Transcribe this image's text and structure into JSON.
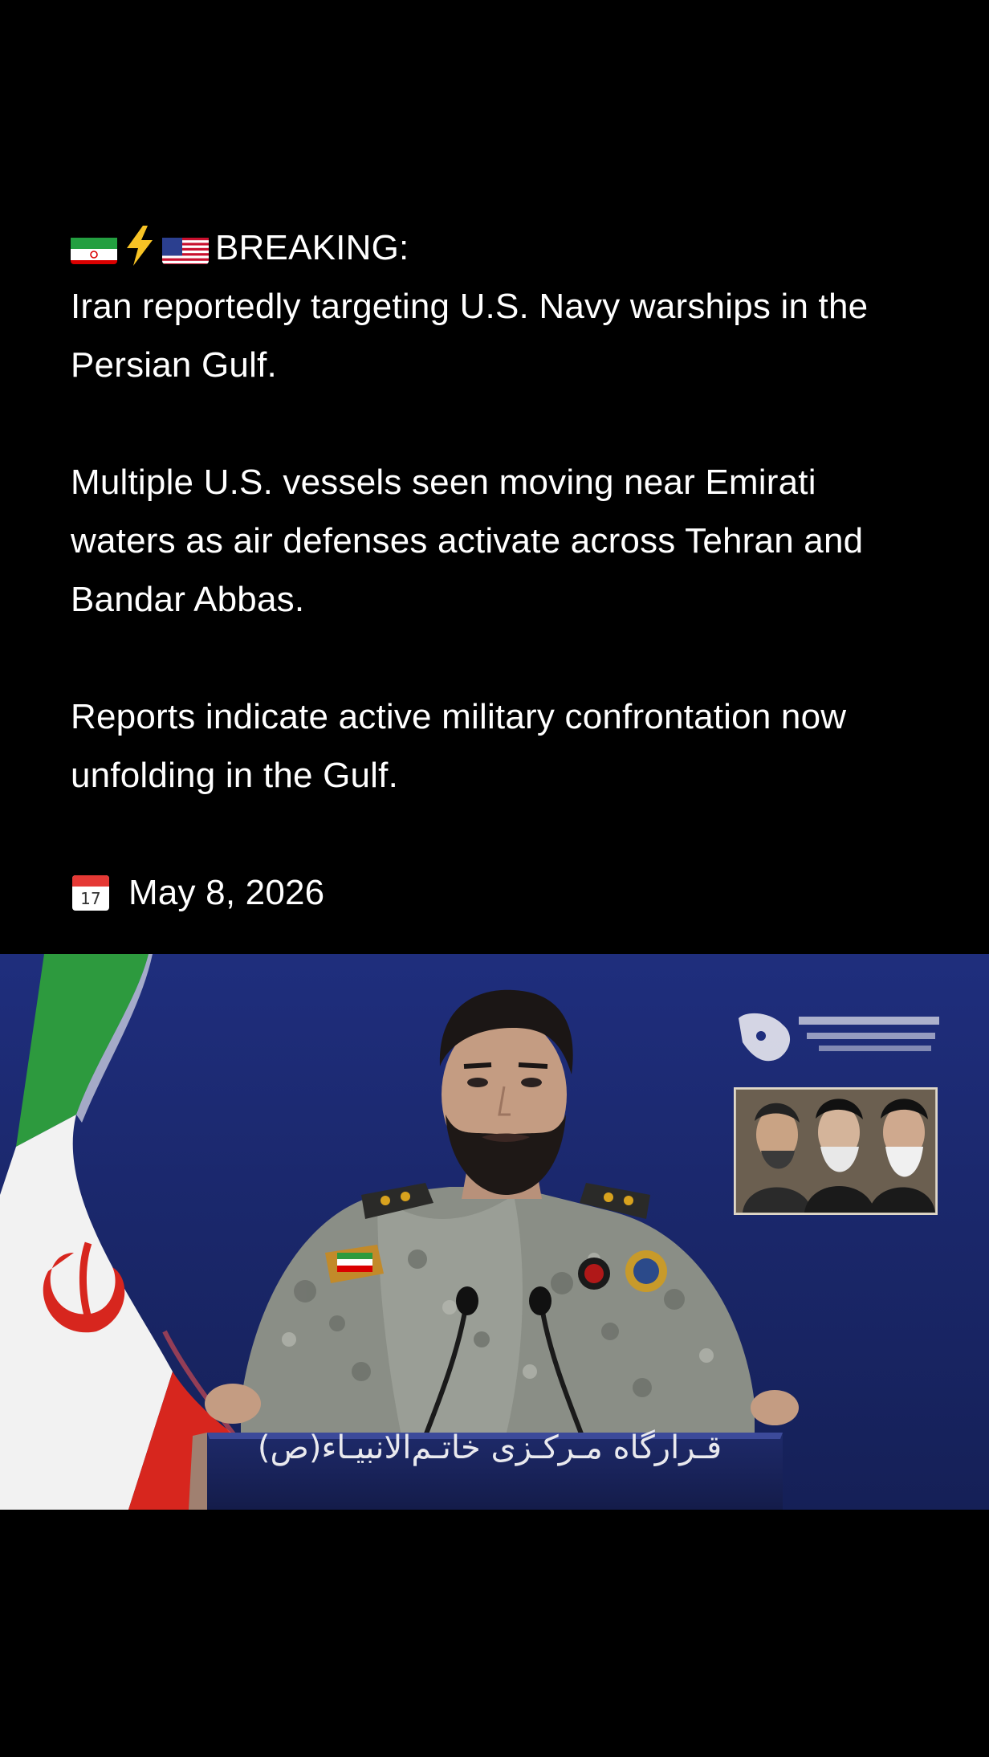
{
  "post": {
    "headline": "BREAKING:",
    "lines": {
      "l1": "Iran reportedly targeting U.S. Navy warships in the",
      "l2": "Persian Gulf.",
      "l3": "Multiple U.S. vessels seen moving near Emirati",
      "l4": "waters as air defenses activate across Tehran and",
      "l5": "Bandar Abbas.",
      "l6": "Reports indicate active military confrontation now",
      "l7": "unfolding in the Gulf."
    },
    "date": "May 8, 2026",
    "icons": {
      "lead": [
        "iran-flag-icon",
        "lightning-icon",
        "us-flag-icon"
      ],
      "date": "calendar-icon"
    }
  },
  "image": {
    "podium_text": "قـرارگاه مـرکـزی خاتـم‌الانبیـاء(ص)"
  }
}
